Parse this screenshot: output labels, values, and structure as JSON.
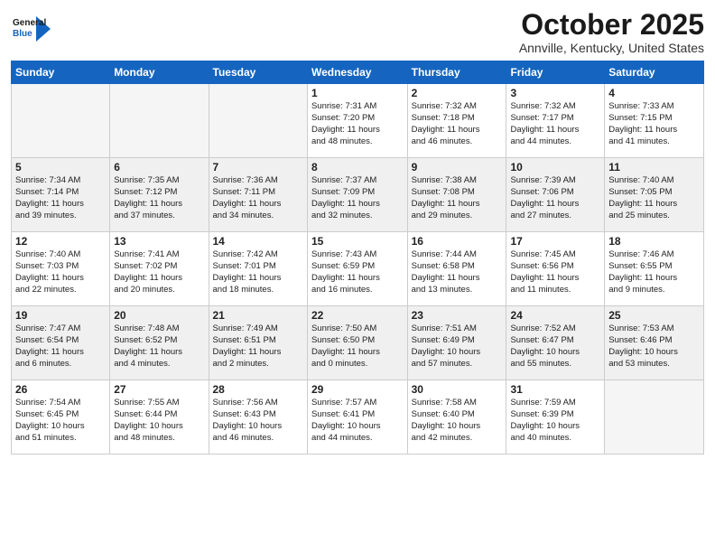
{
  "logo": {
    "general": "General",
    "blue": "Blue"
  },
  "header": {
    "month": "October 2025",
    "location": "Annville, Kentucky, United States"
  },
  "weekdays": [
    "Sunday",
    "Monday",
    "Tuesday",
    "Wednesday",
    "Thursday",
    "Friday",
    "Saturday"
  ],
  "weeks": [
    [
      {
        "day": "",
        "info": ""
      },
      {
        "day": "",
        "info": ""
      },
      {
        "day": "",
        "info": ""
      },
      {
        "day": "1",
        "info": "Sunrise: 7:31 AM\nSunset: 7:20 PM\nDaylight: 11 hours\nand 48 minutes."
      },
      {
        "day": "2",
        "info": "Sunrise: 7:32 AM\nSunset: 7:18 PM\nDaylight: 11 hours\nand 46 minutes."
      },
      {
        "day": "3",
        "info": "Sunrise: 7:32 AM\nSunset: 7:17 PM\nDaylight: 11 hours\nand 44 minutes."
      },
      {
        "day": "4",
        "info": "Sunrise: 7:33 AM\nSunset: 7:15 PM\nDaylight: 11 hours\nand 41 minutes."
      }
    ],
    [
      {
        "day": "5",
        "info": "Sunrise: 7:34 AM\nSunset: 7:14 PM\nDaylight: 11 hours\nand 39 minutes."
      },
      {
        "day": "6",
        "info": "Sunrise: 7:35 AM\nSunset: 7:12 PM\nDaylight: 11 hours\nand 37 minutes."
      },
      {
        "day": "7",
        "info": "Sunrise: 7:36 AM\nSunset: 7:11 PM\nDaylight: 11 hours\nand 34 minutes."
      },
      {
        "day": "8",
        "info": "Sunrise: 7:37 AM\nSunset: 7:09 PM\nDaylight: 11 hours\nand 32 minutes."
      },
      {
        "day": "9",
        "info": "Sunrise: 7:38 AM\nSunset: 7:08 PM\nDaylight: 11 hours\nand 29 minutes."
      },
      {
        "day": "10",
        "info": "Sunrise: 7:39 AM\nSunset: 7:06 PM\nDaylight: 11 hours\nand 27 minutes."
      },
      {
        "day": "11",
        "info": "Sunrise: 7:40 AM\nSunset: 7:05 PM\nDaylight: 11 hours\nand 25 minutes."
      }
    ],
    [
      {
        "day": "12",
        "info": "Sunrise: 7:40 AM\nSunset: 7:03 PM\nDaylight: 11 hours\nand 22 minutes."
      },
      {
        "day": "13",
        "info": "Sunrise: 7:41 AM\nSunset: 7:02 PM\nDaylight: 11 hours\nand 20 minutes."
      },
      {
        "day": "14",
        "info": "Sunrise: 7:42 AM\nSunset: 7:01 PM\nDaylight: 11 hours\nand 18 minutes."
      },
      {
        "day": "15",
        "info": "Sunrise: 7:43 AM\nSunset: 6:59 PM\nDaylight: 11 hours\nand 16 minutes."
      },
      {
        "day": "16",
        "info": "Sunrise: 7:44 AM\nSunset: 6:58 PM\nDaylight: 11 hours\nand 13 minutes."
      },
      {
        "day": "17",
        "info": "Sunrise: 7:45 AM\nSunset: 6:56 PM\nDaylight: 11 hours\nand 11 minutes."
      },
      {
        "day": "18",
        "info": "Sunrise: 7:46 AM\nSunset: 6:55 PM\nDaylight: 11 hours\nand 9 minutes."
      }
    ],
    [
      {
        "day": "19",
        "info": "Sunrise: 7:47 AM\nSunset: 6:54 PM\nDaylight: 11 hours\nand 6 minutes."
      },
      {
        "day": "20",
        "info": "Sunrise: 7:48 AM\nSunset: 6:52 PM\nDaylight: 11 hours\nand 4 minutes."
      },
      {
        "day": "21",
        "info": "Sunrise: 7:49 AM\nSunset: 6:51 PM\nDaylight: 11 hours\nand 2 minutes."
      },
      {
        "day": "22",
        "info": "Sunrise: 7:50 AM\nSunset: 6:50 PM\nDaylight: 11 hours\nand 0 minutes."
      },
      {
        "day": "23",
        "info": "Sunrise: 7:51 AM\nSunset: 6:49 PM\nDaylight: 10 hours\nand 57 minutes."
      },
      {
        "day": "24",
        "info": "Sunrise: 7:52 AM\nSunset: 6:47 PM\nDaylight: 10 hours\nand 55 minutes."
      },
      {
        "day": "25",
        "info": "Sunrise: 7:53 AM\nSunset: 6:46 PM\nDaylight: 10 hours\nand 53 minutes."
      }
    ],
    [
      {
        "day": "26",
        "info": "Sunrise: 7:54 AM\nSunset: 6:45 PM\nDaylight: 10 hours\nand 51 minutes."
      },
      {
        "day": "27",
        "info": "Sunrise: 7:55 AM\nSunset: 6:44 PM\nDaylight: 10 hours\nand 48 minutes."
      },
      {
        "day": "28",
        "info": "Sunrise: 7:56 AM\nSunset: 6:43 PM\nDaylight: 10 hours\nand 46 minutes."
      },
      {
        "day": "29",
        "info": "Sunrise: 7:57 AM\nSunset: 6:41 PM\nDaylight: 10 hours\nand 44 minutes."
      },
      {
        "day": "30",
        "info": "Sunrise: 7:58 AM\nSunset: 6:40 PM\nDaylight: 10 hours\nand 42 minutes."
      },
      {
        "day": "31",
        "info": "Sunrise: 7:59 AM\nSunset: 6:39 PM\nDaylight: 10 hours\nand 40 minutes."
      },
      {
        "day": "",
        "info": ""
      }
    ]
  ]
}
